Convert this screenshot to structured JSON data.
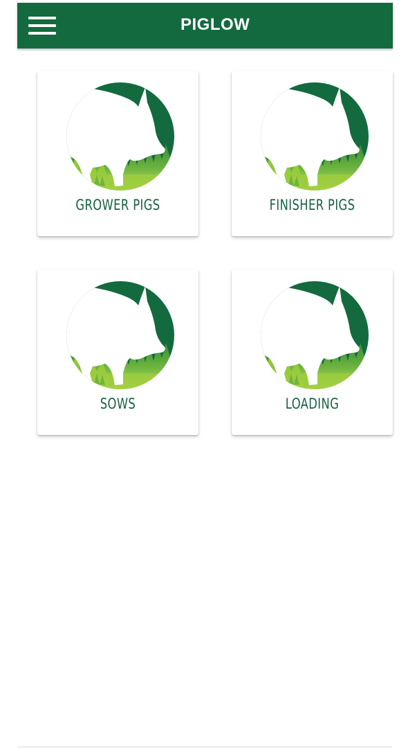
{
  "app_bar": {
    "title": "PIGLOW",
    "menu_icon": "hamburger-menu-icon",
    "background_color": "#136a3e"
  },
  "categories": [
    {
      "label": "GROWER PIGS",
      "icon": "pig-logo-icon"
    },
    {
      "label": "FINISHER PIGS",
      "icon": "pig-logo-icon"
    },
    {
      "label": "SOWS",
      "icon": "pig-logo-icon"
    },
    {
      "label": "LOADING",
      "icon": "pig-logo-icon"
    }
  ],
  "colors": {
    "brand_dark_green": "#136a3e",
    "grass_light_green": "#9ccc3c",
    "grass_mid_green": "#3f9a3c",
    "label_green": "#176140"
  }
}
